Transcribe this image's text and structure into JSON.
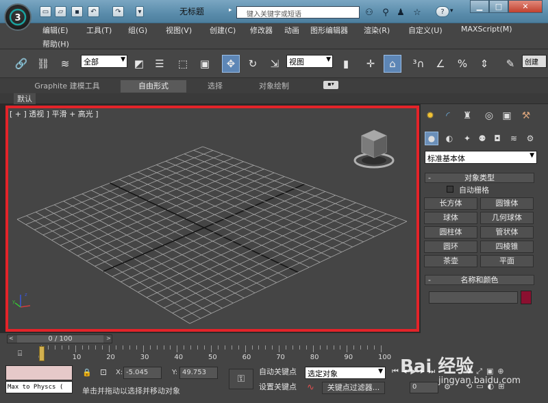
{
  "titlebar": {
    "doc_title": "无标题",
    "search_placeholder": "键入关键字或短语",
    "help_label": "?",
    "quick_icons": [
      "new-file-icon",
      "open-folder-icon",
      "save-icon",
      "undo-icon",
      "redo-icon"
    ]
  },
  "menu": {
    "items": [
      "编辑(E)",
      "工具(T)",
      "组(G)",
      "视图(V)",
      "创建(C)",
      "修改器",
      "动画",
      "图形编辑器",
      "渲染(R)",
      "自定义(U)",
      "MAXScript(M)",
      "帮助(H)"
    ]
  },
  "toolbar": {
    "selection_filter": "全部",
    "ref_coord": "视图",
    "create_selection": "创建"
  },
  "ribbon": {
    "tabs": [
      "Graphite 建模工具",
      "自由形式",
      "选择",
      "对象绘制"
    ],
    "active_tab": "自由形式",
    "sub_label": "默认"
  },
  "viewport": {
    "label": "[ + ] 透视 ] 平滑 + 高光 ]"
  },
  "command_panel": {
    "category": "标准基本体",
    "object_type_title": "对象类型",
    "autogrid_label": "自动栅格",
    "objects": [
      "长方体",
      "圆锥体",
      "球体",
      "几何球体",
      "圆柱体",
      "管状体",
      "圆环",
      "四棱锥",
      "茶壶",
      "平面"
    ],
    "name_color_title": "名称和颜色",
    "name_value": "",
    "object_color": "#8b1030"
  },
  "timeline": {
    "frame_label": "0 / 100",
    "ticks": [
      "0",
      "10",
      "20",
      "30",
      "40",
      "50",
      "60",
      "70",
      "80",
      "90",
      "100"
    ]
  },
  "status": {
    "listener_text": "Max to Physcs (",
    "x_label": "X:",
    "x_value": "-5.045",
    "y_label": "Y:",
    "y_value": "49.753",
    "autokey_label": "自动关键点",
    "setkey_label": "设置关键点",
    "selected_object": "选定对象",
    "key_filter_label": "关键点过滤器...",
    "prompt": "单击并拖动以选择并移动对象",
    "frame_value": "0"
  },
  "watermark": {
    "text": "Bai 经验",
    "url": "jingyan.baidu.com"
  }
}
